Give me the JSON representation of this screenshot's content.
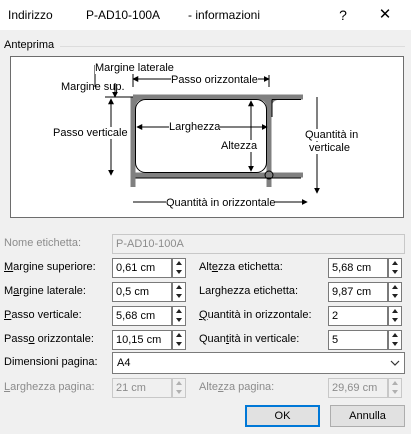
{
  "title_bar": {
    "part1": "Indirizzo",
    "part2": "P-AD10-100A",
    "part3": "- informazioni",
    "help_glyph": "?",
    "close_glyph": "✕"
  },
  "preview": {
    "group_label": "Anteprima",
    "labels": {
      "margine_laterale": "Margine laterale",
      "passo_orizzontale": "Passo orizzontale",
      "margine_sup": "Margine sup.",
      "larghezza": "Larghezza",
      "passo_verticale": "Passo verticale",
      "altezza": "Altezza",
      "quantita_verticale_1": "Quantità in",
      "quantita_verticale_2": "verticale",
      "quantita_orizzontale": "Quantità in orizzontale"
    }
  },
  "form": {
    "nome_etichetta": {
      "label": "Nome etichetta:",
      "value": "P-AD10-100A"
    },
    "margine_superiore": {
      "label_a": "M",
      "label_b": "argine superiore:",
      "value": "0,61 cm"
    },
    "altezza_etichetta": {
      "label_a": "Alt",
      "label_b": "e",
      "label_c": "zza etichetta:",
      "value": "5,68 cm"
    },
    "margine_laterale": {
      "label_a": "M",
      "label_b": "a",
      "label_c": "rgine laterale:",
      "value": "0,5 cm"
    },
    "larghezza_etichetta": {
      "label_a": "Lar",
      "label_b": "g",
      "label_c": "hezza etichetta:",
      "value": "9,87 cm"
    },
    "passo_verticale": {
      "label_a": "P",
      "label_b": "asso verticale:",
      "value": "5,68 cm"
    },
    "quantita_orizzontale": {
      "label_a": "Q",
      "label_b": "uantità in orizzontale:",
      "value": "2"
    },
    "passo_orizzontale": {
      "label_a": "Pass",
      "label_b": "o",
      "label_c": " orizzontale:",
      "value": "10,15 cm"
    },
    "quantita_verticale": {
      "label_a": "Quan",
      "label_b": "t",
      "label_c": "ità in verticale:",
      "value": "5"
    },
    "dimensioni_pagina": {
      "label": "Dimensioni pagina:",
      "value": "A4"
    },
    "larghezza_pagina": {
      "label_a": "L",
      "label_b": "arghezza pagina:",
      "value": "21 cm"
    },
    "altezza_pagina": {
      "label_a": "Alte",
      "label_b": "z",
      "label_c": "za pagina:",
      "value": "29,69 cm"
    }
  },
  "buttons": {
    "ok": "OK",
    "cancel": "Annulla"
  }
}
